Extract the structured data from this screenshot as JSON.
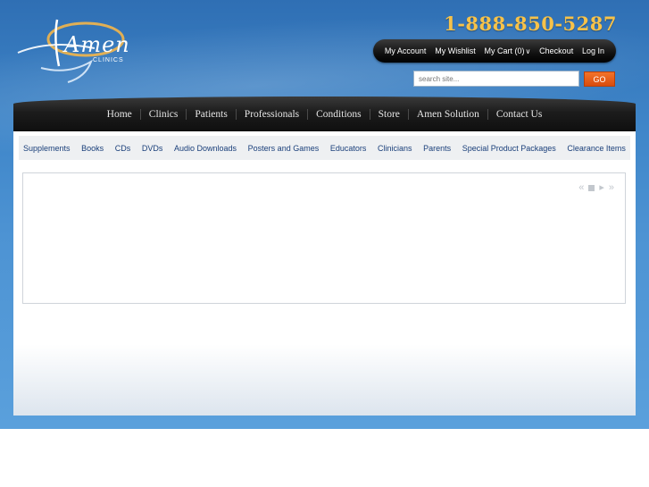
{
  "header": {
    "logo_text": "Amen",
    "logo_subtext": "CLINICS",
    "phone": "1-888-850-5287"
  },
  "account_nav": {
    "items": [
      "My Account",
      "My Wishlist",
      "My Cart (0)",
      "Checkout",
      "Log In"
    ]
  },
  "search": {
    "placeholder": "search site...",
    "button_label": "GO"
  },
  "main_nav": {
    "items": [
      "Home",
      "Clinics",
      "Patients",
      "Professionals",
      "Conditions",
      "Store",
      "Amen Solution",
      "Contact Us"
    ]
  },
  "sub_nav": {
    "items": [
      "Supplements",
      "Books",
      "CDs",
      "DVDs",
      "Audio Downloads",
      "Posters and Games",
      "Educators",
      "Clinicians",
      "Parents",
      "Special Product Packages",
      "Clearance Items"
    ]
  },
  "slider": {
    "controls": [
      "previous-icon",
      "stop-icon",
      "play-icon",
      "next-icon"
    ]
  },
  "colors": {
    "accent_orange": "#e0571a",
    "phone_gold": "#f6c24a",
    "nav_dark": "#111111",
    "link_blue": "#1a3f7a",
    "background_blue": "#4d93d3"
  }
}
